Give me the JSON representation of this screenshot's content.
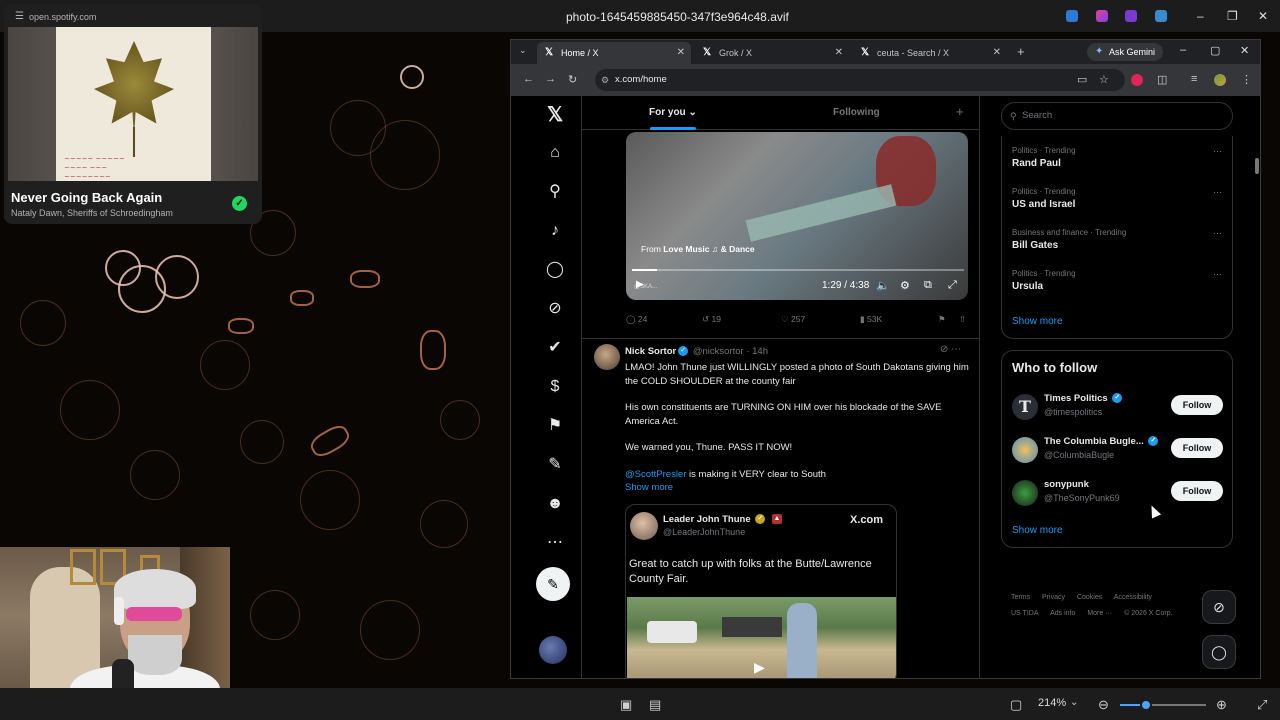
{
  "viewer": {
    "title": "photo-1645459885450-347f3e964c48.avif",
    "zoom": "214%",
    "zoom_fraction": 0.3
  },
  "spotify": {
    "url": "open.spotify.com",
    "track_title": "Never Going Back Again",
    "artists": "Nataly Dawn, Sheriffs of Schroedingham"
  },
  "browser": {
    "tabs": [
      {
        "label": "Home / X"
      },
      {
        "label": "Grok / X"
      },
      {
        "label": "ceuta - Search / X"
      }
    ],
    "ask_gemini": "Ask Gemini",
    "url": "x.com/home"
  },
  "feed": {
    "tab_for_you": "For you",
    "tab_following": "Following",
    "video": {
      "from_prefix": "From",
      "from_channel": "Love Music ♫ & Dance",
      "time": "1:29 / 4:38",
      "progress_fraction": 0.075
    },
    "actions": {
      "replies": "24",
      "reposts": "19",
      "likes": "257",
      "views": "53K"
    },
    "tweet": {
      "name": "Nick Sortor",
      "handle": "@nicksortor",
      "time": "14h",
      "para1": "LMAO! John Thune just WILLINGLY posted a photo of South Dakotans giving him the COLD SHOULDER at the county fair",
      "para2": "His own constituents are TURNING ON HIM over his blockade of the SAVE America Act.",
      "para3": "We warned you, Thune. PASS IT NOW!",
      "mention": "@ScottPresler",
      "para4_rest": " is making it VERY clear to South",
      "show_more": "Show more",
      "quote": {
        "name": "Leader John Thune",
        "handle": "@LeaderJohnThune",
        "source": "X.com",
        "text": "Great to catch up with folks at the Butte/Lawrence County Fair."
      }
    }
  },
  "sidebar": {
    "search_placeholder": "Search",
    "trends": [
      {
        "category": "Politics · Trending",
        "name": "Rand Paul"
      },
      {
        "category": "Politics · Trending",
        "name": "US and Israel"
      },
      {
        "category": "Business and finance · Trending",
        "name": "Bill Gates"
      },
      {
        "category": "Politics · Trending",
        "name": "Ursula"
      }
    ],
    "show_more": "Show more",
    "who_to_follow": {
      "title": "Who to follow",
      "follow_label": "Follow",
      "accounts": [
        {
          "name": "Times Politics",
          "handle": "@timespolitics"
        },
        {
          "name": "The Columbia Bugle...",
          "handle": "@ColumbiaBugle"
        },
        {
          "name": "sonypunk",
          "handle": "@TheSonyPunk69"
        }
      ],
      "show_more": "Show more"
    },
    "footer": {
      "terms": "Terms",
      "privacy": "Privacy",
      "cookies": "Cookies",
      "accessibility": "Accessibility",
      "ustida": "US TIDA",
      "ads_info": "Ads info",
      "more": "More ···",
      "copyright": "© 2026 X Corp."
    }
  }
}
